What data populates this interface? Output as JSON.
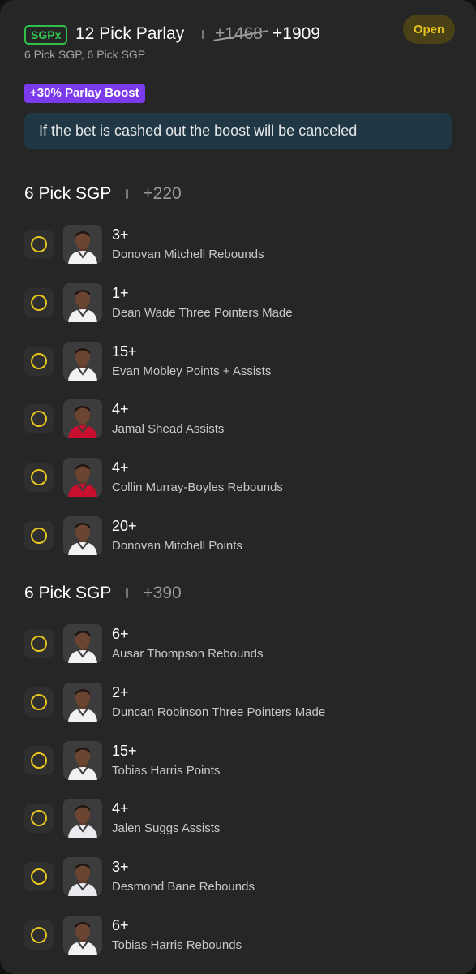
{
  "header": {
    "badge": "SGPx",
    "title": "12 Pick Parlay",
    "odds_original": "+1468",
    "odds_boosted": "+1909",
    "subtitle": "6 Pick SGP, 6 Pick SGP",
    "status": "Open"
  },
  "boost": {
    "label": "+30% Parlay Boost",
    "notice": "If the bet is cashed out the boost will be canceled"
  },
  "colors": {
    "background": "#262626",
    "accent_green": "#35c853",
    "accent_purple": "#7c3aed",
    "pending_ring": "#e6c51f",
    "open_text": "#e8c21c"
  },
  "sections": [
    {
      "title": "6 Pick SGP",
      "odds": "+220",
      "legs": [
        {
          "value": "3+",
          "desc": "Donovan Mitchell Rebounds",
          "jersey": "#f2f2f2"
        },
        {
          "value": "1+",
          "desc": "Dean Wade Three Pointers Made",
          "jersey": "#f2f2f2"
        },
        {
          "value": "15+",
          "desc": "Evan Mobley Points + Assists",
          "jersey": "#f2f2f2"
        },
        {
          "value": "4+",
          "desc": "Jamal Shead Assists",
          "jersey": "#c8102e"
        },
        {
          "value": "4+",
          "desc": "Collin Murray-Boyles Rebounds",
          "jersey": "#c8102e"
        },
        {
          "value": "20+",
          "desc": "Donovan Mitchell Points",
          "jersey": "#f2f2f2"
        }
      ]
    },
    {
      "title": "6 Pick SGP",
      "odds": "+390",
      "legs": [
        {
          "value": "6+",
          "desc": "Ausar Thompson Rebounds",
          "jersey": "#f2f2f2"
        },
        {
          "value": "2+",
          "desc": "Duncan Robinson Three Pointers Made",
          "jersey": "#f2f2f2"
        },
        {
          "value": "15+",
          "desc": "Tobias Harris Points",
          "jersey": "#f2f2f2"
        },
        {
          "value": "4+",
          "desc": "Jalen Suggs Assists",
          "jersey": "#e8eaf0"
        },
        {
          "value": "3+",
          "desc": "Desmond Bane Rebounds",
          "jersey": "#e8eaf0"
        },
        {
          "value": "6+",
          "desc": "Tobias Harris Rebounds",
          "jersey": "#f2f2f2"
        }
      ]
    }
  ]
}
